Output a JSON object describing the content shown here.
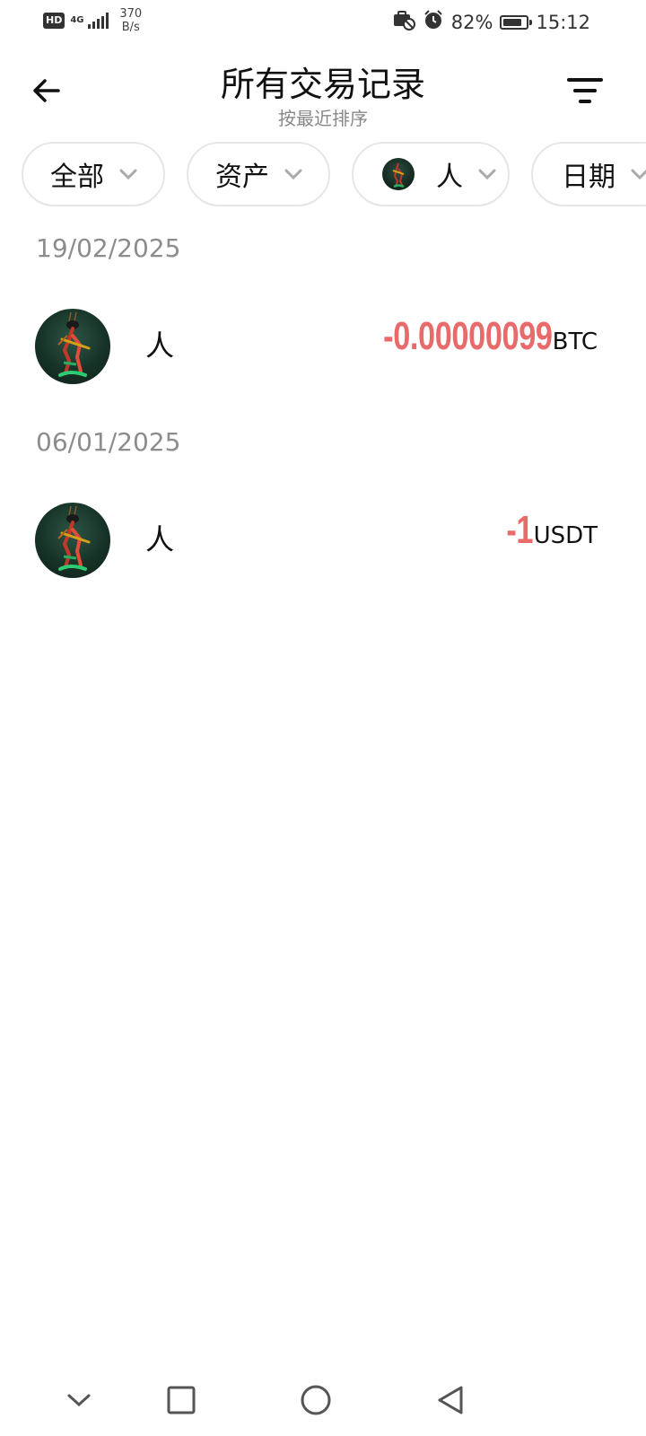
{
  "status_bar": {
    "hd": "HD",
    "network": "4G",
    "speed_value": "370",
    "speed_unit": "B/s",
    "battery_percent": "82%",
    "battery_level": 0.82,
    "time": "15:12",
    "icons": [
      "briefcase-off-icon",
      "alarm-icon",
      "battery-icon"
    ]
  },
  "header": {
    "title": "所有交易记录",
    "subtitle": "按最近排序",
    "back_icon": "arrow-left-icon",
    "filter_icon": "filter-icon"
  },
  "filters": [
    {
      "label": "全部"
    },
    {
      "label": "资产"
    },
    {
      "label": "人"
    },
    {
      "label": "日期"
    }
  ],
  "transactions": [
    {
      "date": "19/02/2025",
      "name": "人",
      "amount": "-0.00000099",
      "currency": "BTC"
    },
    {
      "date": "06/01/2025",
      "name": "人",
      "amount": "-1",
      "currency": "USDT"
    }
  ],
  "colors": {
    "negative_amount": "#e86a6a",
    "date_header": "#8c8c8c",
    "chip_border": "#e6e6e6"
  },
  "nav": {
    "icons": [
      "chevron-down-icon",
      "square-icon",
      "circle-icon",
      "triangle-back-icon"
    ]
  }
}
